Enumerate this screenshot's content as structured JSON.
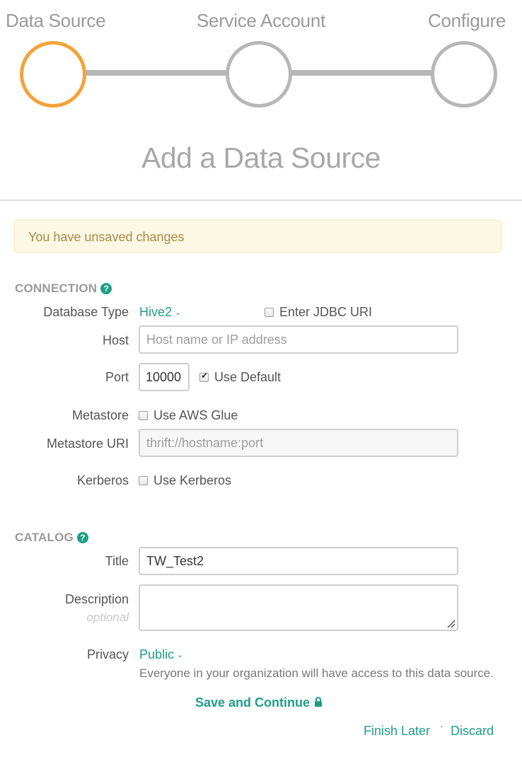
{
  "stepper": {
    "steps": [
      {
        "label": "Data Source",
        "active": true
      },
      {
        "label": "Service Account",
        "active": false
      },
      {
        "label": "Configure",
        "active": false
      }
    ],
    "active_color": "#f4a339",
    "inactive_color": "#b7b7b7"
  },
  "page_title": "Add a Data Source",
  "alert": {
    "text": "You have unsaved changes"
  },
  "connection": {
    "heading": "CONNECTION",
    "help_icon": "question-circle-icon",
    "database_type": {
      "label": "Database Type",
      "value": "Hive2"
    },
    "jdbc_uri": {
      "label": "Enter JDBC URI",
      "checked": false
    },
    "host": {
      "label": "Host",
      "placeholder": "Host name or IP address",
      "value": ""
    },
    "port": {
      "label": "Port",
      "value": "10000",
      "use_default_label": "Use Default",
      "use_default_checked": true
    },
    "metastore": {
      "label": "Metastore",
      "checkbox_label": "Use AWS Glue",
      "checked": false
    },
    "metastore_uri": {
      "label": "Metastore URI",
      "placeholder": "thrift://hostname:port",
      "value": ""
    },
    "kerberos": {
      "label": "Kerberos",
      "checkbox_label": "Use Kerberos",
      "checked": false
    }
  },
  "catalog": {
    "heading": "CATALOG",
    "help_icon": "question-circle-icon",
    "title": {
      "label": "Title",
      "value": "TW_Test2"
    },
    "description": {
      "label": "Description",
      "sublabel": "optional",
      "value": ""
    },
    "privacy": {
      "label": "Privacy",
      "value": "Public",
      "help": "Everyone in your organization will have access to this data source."
    }
  },
  "actions": {
    "save_continue": "Save and Continue",
    "finish_later": "Finish Later",
    "separator": "·",
    "discard": "Discard"
  },
  "colors": {
    "accent": "#1e9e86",
    "alert_bg": "#fcf8e3",
    "alert_text": "#a88b4a"
  }
}
